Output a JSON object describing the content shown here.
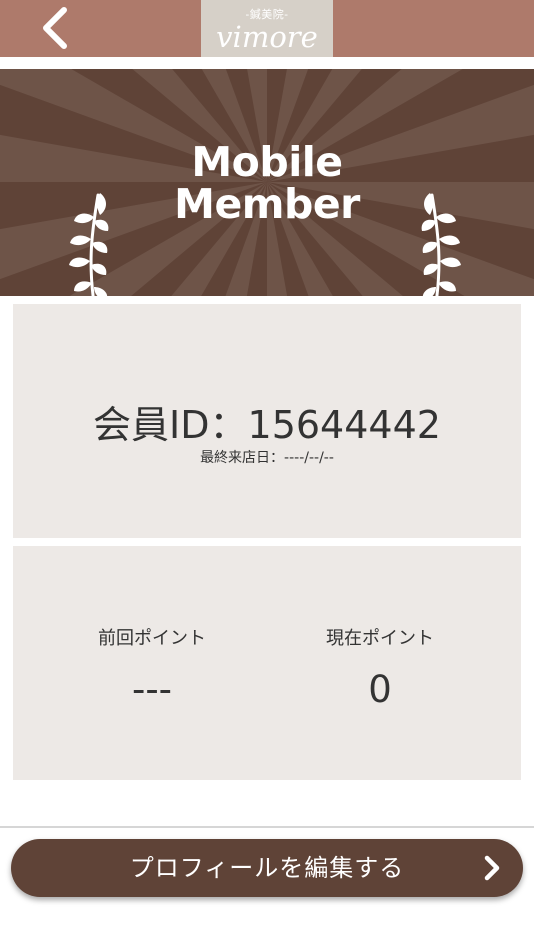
{
  "header": {
    "back_icon": "chevron-left-icon",
    "logo_sub": "-鍼美院-",
    "logo_main": "vimore",
    "bar_color": "#ae7a6b"
  },
  "banner": {
    "line1": "Mobile",
    "line2": "Member",
    "icon": "laurel-branch-icon",
    "background_color": "#5f4337"
  },
  "member_card": {
    "id_text": "会員ID：15644442",
    "last_visit_text": "最終来店日：----/--/--"
  },
  "points": {
    "previous_label": "前回ポイント",
    "previous_value": "---",
    "current_label": "現在ポイント",
    "current_value": "0"
  },
  "edit_button": {
    "label": "プロフィールを編集する",
    "icon": "chevron-right-icon",
    "color": "#5f4337"
  }
}
